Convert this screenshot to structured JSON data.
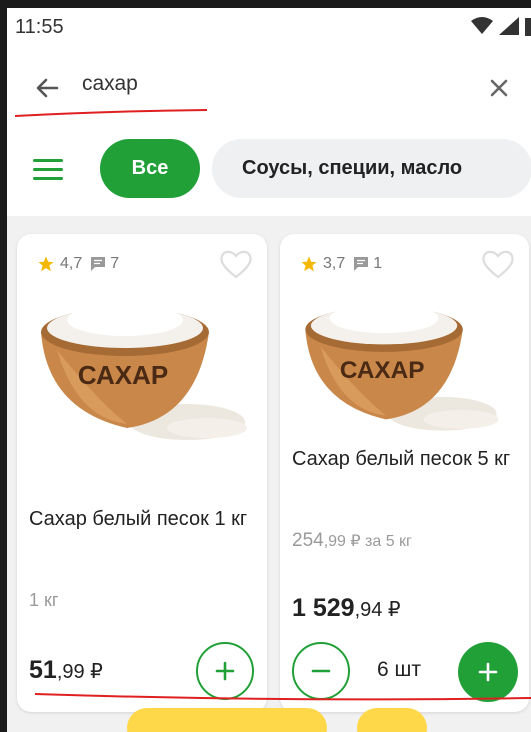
{
  "status_bar": {
    "time": "11:55"
  },
  "search": {
    "query": "сахар"
  },
  "filters": {
    "all_label": "Все",
    "category_label": "Соусы, специи, масло"
  },
  "products": [
    {
      "rating": "4,7",
      "reviews": "7",
      "image_label": "САХАР",
      "title": "Сахар белый песок 1 кг",
      "subtitle": "1 кг",
      "price_main": "51",
      "price_cents": ",99 ₽"
    },
    {
      "rating": "3,7",
      "reviews": "1",
      "image_label": "САХАР",
      "title": "Сахар белый песок 5 кг",
      "unit_price_main": "254",
      "unit_price_rest": ",99 ₽ за 5 кг",
      "price_main": "1 529",
      "price_cents": ",94 ₽",
      "quantity": "6 шт"
    }
  ],
  "colors": {
    "accent_green": "#21a038",
    "star_yellow": "#f5b800",
    "annotation_red": "#e02020"
  }
}
